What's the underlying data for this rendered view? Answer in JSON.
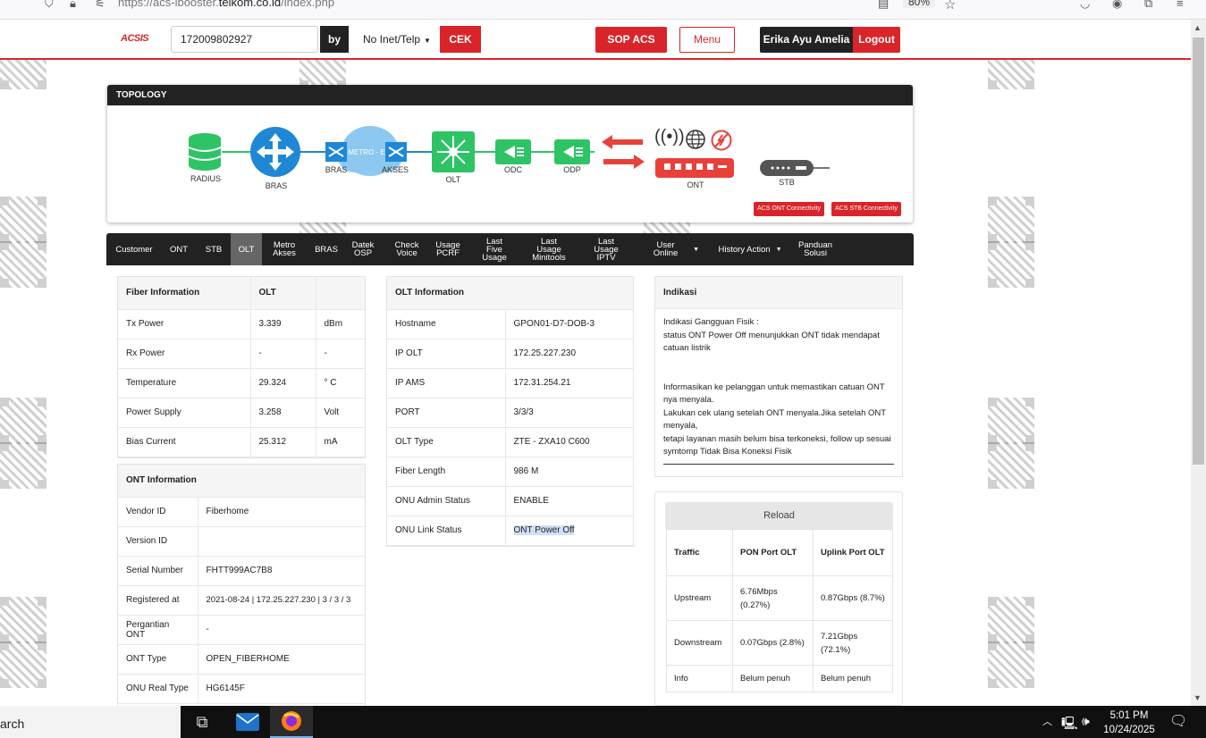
{
  "browser": {
    "url_prefix": "https://acs-ibooster.",
    "url_domain": "telkom.co.id",
    "url_path": "/index.php",
    "zoom": "80%"
  },
  "header": {
    "logo": "ACSIS",
    "search_value": "172009802927",
    "by_label": "by",
    "search_type": "No Inet/Telp",
    "cek_label": "CEK",
    "sop_label": "SOP ACS",
    "menu_label": "Menu",
    "user_name": "Erika Ayu Amelia",
    "logout_label": "Logout"
  },
  "topology": {
    "title": "TOPOLOGY",
    "nodes": {
      "radius": "RADIUS",
      "bras": "BRAS",
      "metro": "METRO - E",
      "bras2": "BRAS",
      "akses": "AKSES",
      "olt": "OLT",
      "odc": "ODC",
      "odp": "ODP",
      "ont": "ONT",
      "stb": "STB"
    },
    "acs_ont_button": "ACS ONT Connectivity",
    "acs_stb_button": "ACS STB Connectivity",
    "colors": {
      "green": "#2ec466",
      "blue": "#1e88d6",
      "red": "#e8413a",
      "cloud": "#8cc8f0"
    }
  },
  "nav": {
    "tabs": [
      {
        "label": "Customer"
      },
      {
        "label": "ONT"
      },
      {
        "label": "STB"
      },
      {
        "label": "OLT",
        "active": true
      },
      {
        "label": "Metro\nAkses"
      },
      {
        "label": "BRAS"
      },
      {
        "label": "Datek\nOSP"
      },
      {
        "label": "Check\nVoice"
      },
      {
        "label": "Usage\nPCRF"
      },
      {
        "label": "Last Five\nUsage"
      },
      {
        "label": "Last Usage\nMinitools"
      },
      {
        "label": "Last Usage\nIPTV"
      },
      {
        "label": "User Online"
      },
      {
        "label": "History Action"
      },
      {
        "label": "Panduan\nSolusi"
      }
    ]
  },
  "fiber_info": {
    "header": [
      "Fiber Information",
      "OLT",
      ""
    ],
    "rows": [
      [
        "Tx Power",
        "3.339",
        "dBm"
      ],
      [
        "Rx Power",
        "-",
        "-"
      ],
      [
        "Temperature",
        "29.324",
        "° C"
      ],
      [
        "Power Supply",
        "3.258",
        "Volt"
      ],
      [
        "Bias Current",
        "25.312",
        "mA"
      ]
    ]
  },
  "ont_info": {
    "header": "ONT Information",
    "rows": [
      [
        "Vendor ID",
        "Fiberhome"
      ],
      [
        "Version ID",
        ""
      ],
      [
        "Serial Number",
        "FHTT999AC7B8"
      ],
      [
        "Registered at",
        "2021-08-24 | 172.25.227.230 | 3 / 3 / 3"
      ],
      [
        "Pergantian ONT",
        "-"
      ],
      [
        "ONT Type",
        "OPEN_FIBERHOME"
      ],
      [
        "ONU Real Type",
        "HG6145F"
      ]
    ]
  },
  "olt_info": {
    "header": "OLT Information",
    "rows": [
      [
        "Hostname",
        "GPON01-D7-DOB-3"
      ],
      [
        "IP OLT",
        "172.25.227.230"
      ],
      [
        "IP AMS",
        "172.31.254.21"
      ],
      [
        "PORT",
        "3/3/3"
      ],
      [
        "OLT Type",
        "ZTE - ZXA10 C600"
      ],
      [
        "Fiber Length",
        "986 M"
      ],
      [
        "ONU Admin Status",
        "ENABLE"
      ],
      [
        "ONU Link Status",
        "ONT Power Off"
      ]
    ]
  },
  "indikasi": {
    "title": "Indikasi",
    "text": "Indikasi Gangguan Fisik :\nstatus ONT Power Off menunjukkan ONT tidak mendapat catuan listrik\n\n\nInformasikan ke pelanggan untuk memastikan catuan ONT nya menyala.\nLakukan cek ulang setelah ONT menyala.Jika setelah ONT menyala,\ntetapi layanan masih belum bisa terkoneksi, follow up sesuai symtomp Tidak Bisa Koneksi Fisik"
  },
  "traffic": {
    "reload_label": "Reload",
    "header": [
      "Traffic",
      "PON Port OLT",
      "Uplink Port OLT"
    ],
    "rows": [
      [
        "Upstream",
        "6.76Mbps (0.27%)",
        "0.87Gbps (8.7%)"
      ],
      [
        "Downstream",
        "0.07Gbps (2.8%)",
        "7.21Gbps (72.1%)"
      ],
      [
        "Info",
        "Belum penuh",
        "Belum penuh"
      ]
    ]
  },
  "taskbar": {
    "search_text": "arch",
    "time": "5:01 PM",
    "date": "10/24/2025"
  }
}
